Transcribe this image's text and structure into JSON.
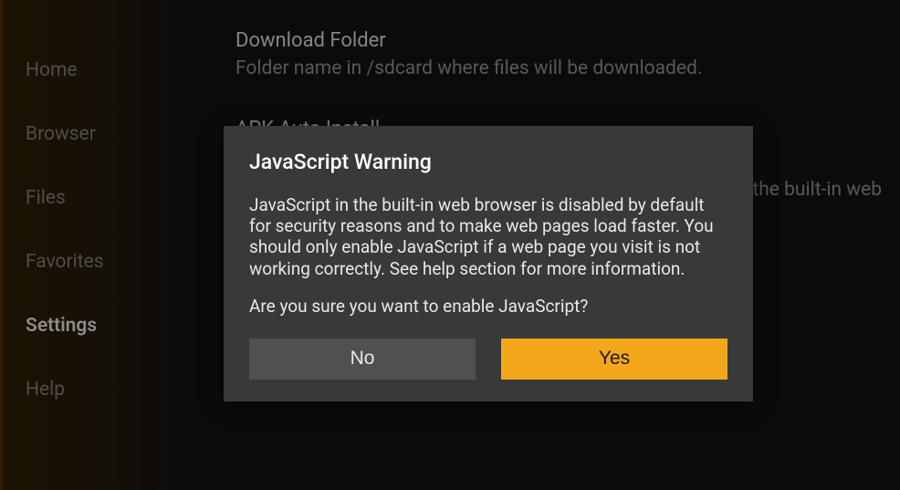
{
  "sidebar": {
    "items": [
      {
        "label": "Home"
      },
      {
        "label": "Browser"
      },
      {
        "label": "Files"
      },
      {
        "label": "Favorites"
      },
      {
        "label": "Settings"
      },
      {
        "label": "Help"
      }
    ],
    "active_index": 4
  },
  "settings": {
    "download": {
      "title": "Download Folder",
      "desc": "Folder name in /sdcard where files will be downloaded."
    },
    "apk": {
      "title": "APK Auto Install"
    },
    "js": {
      "desc_fragment": "the built-in web"
    }
  },
  "dialog": {
    "title": "JavaScript Warning",
    "body": "JavaScript in the built-in web browser is disabled by default for security reasons and to make web pages load faster. You should only enable JavaScript if a web page you visit is not working correctly. See help section for more information.",
    "question": "Are you sure you want to enable JavaScript?",
    "no_label": "No",
    "yes_label": "Yes"
  }
}
